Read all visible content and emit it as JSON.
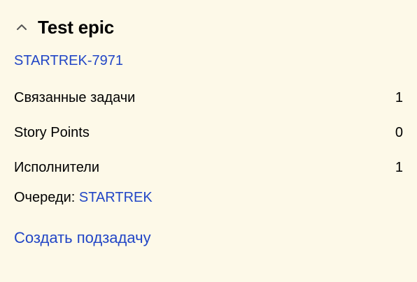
{
  "epic": {
    "title": "Test epic",
    "key": "STARTREK-7971",
    "collapse_icon": "chevron-up-icon"
  },
  "rows": [
    {
      "label": "Связанные задачи",
      "value": "1"
    },
    {
      "label": "Story Points",
      "value": "0"
    },
    {
      "label": "Исполнители",
      "value": "1"
    }
  ],
  "queues": {
    "label": "Очереди:",
    "value": "STARTREK"
  },
  "actions": {
    "create_subtask": "Создать подзадачу"
  },
  "colors": {
    "background": "#fdf9e8",
    "link": "#2246c6",
    "text": "#000000"
  }
}
